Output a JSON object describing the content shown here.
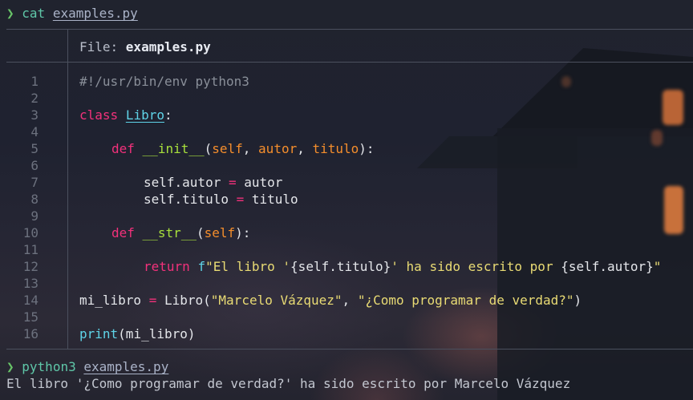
{
  "prompt": {
    "symbol": "❯",
    "first_command": "cat",
    "first_argument": "examples.py",
    "second_command": "python3",
    "second_argument": "examples.py"
  },
  "file_header": {
    "label": "File: ",
    "filename": "examples.py"
  },
  "line_numbers": [
    "1",
    "2",
    "3",
    "4",
    "5",
    "6",
    "7",
    "8",
    "9",
    "10",
    "11",
    "12",
    "13",
    "14",
    "15",
    "16"
  ],
  "code": {
    "shebang": "#!/usr/bin/env python3",
    "class_kw": "class",
    "class_name": "Libro",
    "colon": ":",
    "def_kw": "def",
    "init_name": "__init__",
    "init_open": "(",
    "param_self": "self",
    "comma_sp": ", ",
    "param_autor": "autor",
    "param_titulo": "titulo",
    "init_close": "):",
    "assign_autor_lhs": "self.autor ",
    "eq": "=",
    "assign_autor_rhs": " autor",
    "assign_titulo_lhs": "self.titulo ",
    "assign_titulo_rhs": " titulo",
    "str_name": "__str__",
    "str_close": "):",
    "return_kw": "return",
    "fstring_prefix": "f",
    "fstring_part1": "\"El libro '",
    "fstring_expr1": "{self.titulo}",
    "fstring_part2": "' ha sido escrito por ",
    "fstring_expr2": "{self.autor}",
    "fstring_end": "\"",
    "inst_lhs": "mi_libro ",
    "inst_call": " Libro(",
    "inst_arg1": "\"Marcelo Vázquez\"",
    "inst_sep": ", ",
    "inst_arg2": "\"¿Como programar de verdad?\"",
    "inst_close": ")",
    "print_name": "print",
    "print_args": "(mi_libro)"
  },
  "output": "El libro '¿Como programar de verdad?' ha sido escrito por Marcelo Vázquez",
  "colors": {
    "keyword": "#f2317b",
    "class_name": "#5fd4e8",
    "function_name": "#a8e03c",
    "parameter": "#f58e2c",
    "string": "#e9db74",
    "comment": "#8a8f99",
    "prompt_arrow": "#68c468",
    "command": "#5fc7a8"
  }
}
